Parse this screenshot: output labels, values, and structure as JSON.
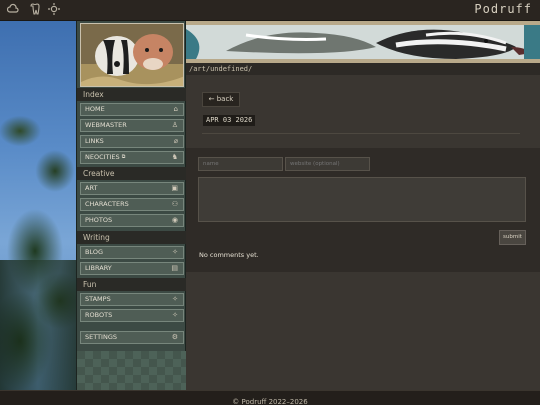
{
  "topbar": {
    "icons": [
      "cloud-icon",
      "tooth-icon",
      "sun-icon"
    ],
    "brand": "Podruff"
  },
  "sidebar": {
    "sections": [
      {
        "title": "Index",
        "items": [
          {
            "label": "HOME",
            "icon": "house-icon",
            "glyph": "⌂"
          },
          {
            "label": "WEBMASTER",
            "icon": "lock-icon",
            "glyph": "♙"
          },
          {
            "label": "LINKS",
            "icon": "paperclip-icon",
            "glyph": "⌀"
          },
          {
            "label": "NEOCITIES",
            "icon": "cat-icon",
            "glyph": "♞",
            "badge": "external-link-icon"
          }
        ]
      },
      {
        "title": "Creative",
        "items": [
          {
            "label": "ART",
            "icon": "image-icon",
            "glyph": "▣"
          },
          {
            "label": "CHARACTERS",
            "icon": "people-icon",
            "glyph": "⚇"
          },
          {
            "label": "PHOTOS",
            "icon": "camera-icon",
            "glyph": "◉"
          }
        ]
      },
      {
        "title": "Writing",
        "items": [
          {
            "label": "BLOG",
            "icon": "sparkle-icon",
            "glyph": "✧"
          },
          {
            "label": "LIBRARY",
            "icon": "book-icon",
            "glyph": "▤"
          }
        ]
      },
      {
        "title": "Fun",
        "items": [
          {
            "label": "STAMPS",
            "icon": "sparkle-icon",
            "glyph": "✧"
          },
          {
            "label": "ROBOTS",
            "icon": "sparkle-icon",
            "glyph": "✧"
          }
        ]
      }
    ],
    "settings": {
      "label": "SETTINGS",
      "icon": "gear-icon",
      "glyph": "⚙"
    }
  },
  "path": "/art/undefined/",
  "post": {
    "back_label": "← back",
    "date": "APR 03 2026"
  },
  "comments": {
    "name_placeholder": "name",
    "website_placeholder": "website (optional)",
    "submit_label": "submit",
    "empty_text": "No comments yet."
  },
  "footer": "© Podruff 2022–2026"
}
